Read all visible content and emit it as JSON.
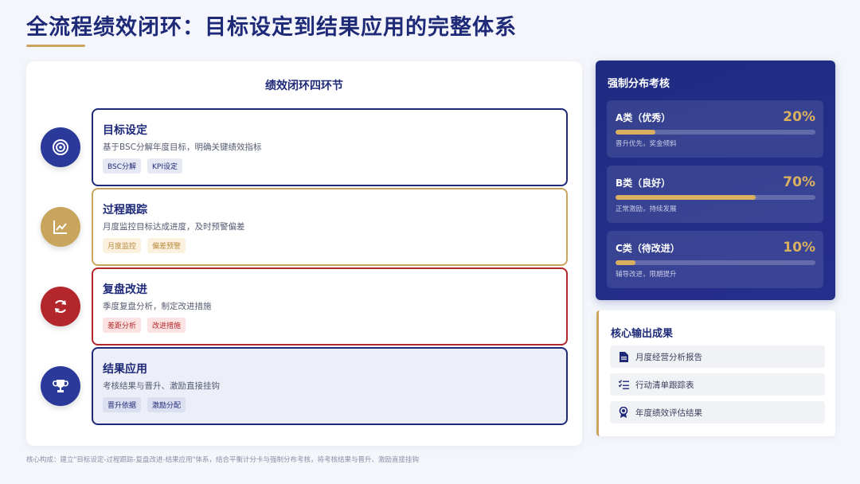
{
  "header": {
    "title": "全流程绩效闭环：目标设定到结果应用的完整体系"
  },
  "loop_panel": {
    "title": "绩效闭环四环节",
    "steps": [
      {
        "heading": "目标设定",
        "description": "基于BSC分解年度目标，明确关键绩效指标",
        "tags": [
          "BSC分解",
          "KPI设定"
        ],
        "icon": "target-icon",
        "color": "#2b3a9a"
      },
      {
        "heading": "过程跟踪",
        "description": "月度监控目标达成进度，及时预警偏差",
        "tags": [
          "月度监控",
          "偏差预警"
        ],
        "icon": "chart-line-icon",
        "color": "#c9a45c"
      },
      {
        "heading": "复盘改进",
        "description": "季度复盘分析，制定改进措施",
        "tags": [
          "差距分析",
          "改进措施"
        ],
        "icon": "refresh-icon",
        "color": "#b3262b"
      },
      {
        "heading": "结果应用",
        "description": "考核结果与晋升、激励直接挂钩",
        "tags": [
          "晋升依据",
          "激励分配"
        ],
        "icon": "trophy-icon",
        "color": "#2b3a9a"
      }
    ]
  },
  "distribution": {
    "title": "强制分布考核",
    "grades": [
      {
        "name": "A类（优秀）",
        "percent_label": "20%",
        "percent": 20,
        "note": "晋升优先，奖金倾斜"
      },
      {
        "name": "B类（良好）",
        "percent_label": "70%",
        "percent": 70,
        "note": "正常激励，持续发展"
      },
      {
        "name": "C类（待改进）",
        "percent_label": "10%",
        "percent": 10,
        "note": "辅导改进，限期提升"
      }
    ]
  },
  "outputs": {
    "title": "核心输出成果",
    "items": [
      {
        "label": "月度经营分析报告",
        "icon": "document-icon"
      },
      {
        "label": "行动清单跟踪表",
        "icon": "checklist-icon"
      },
      {
        "label": "年度绩效评估结果",
        "icon": "award-icon"
      }
    ]
  },
  "footnote": "核心构成：建立\"目标设定-过程跟踪-复盘改进-结果应用\"体系，结合平衡计分卡与强制分布考核，将考核结果与晋升、激励直接挂钩",
  "colors": {
    "navy": "#1e2a78",
    "gold": "#c9a45c",
    "red": "#b3262b"
  }
}
